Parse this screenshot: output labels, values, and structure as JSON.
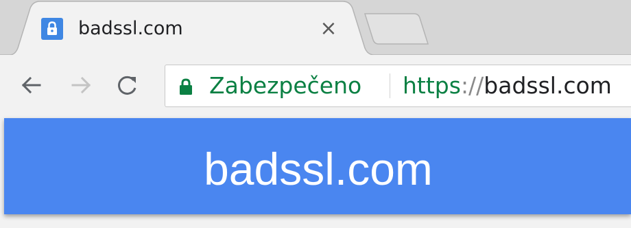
{
  "tab": {
    "title": "badssl.com",
    "close_glyph": "×",
    "favicon_icon": "lock-icon"
  },
  "toolbar": {
    "back_icon": "arrow-left-icon",
    "forward_icon": "arrow-right-icon",
    "reload_icon": "reload-icon"
  },
  "omnibox": {
    "security_label": "Zabezpečeno",
    "url_scheme": "https",
    "url_separator": "://",
    "url_host": "badssl.com",
    "secure_color": "#0b8043"
  },
  "page": {
    "banner_title": "badssl.com",
    "banner_color": "#4a86f0"
  }
}
